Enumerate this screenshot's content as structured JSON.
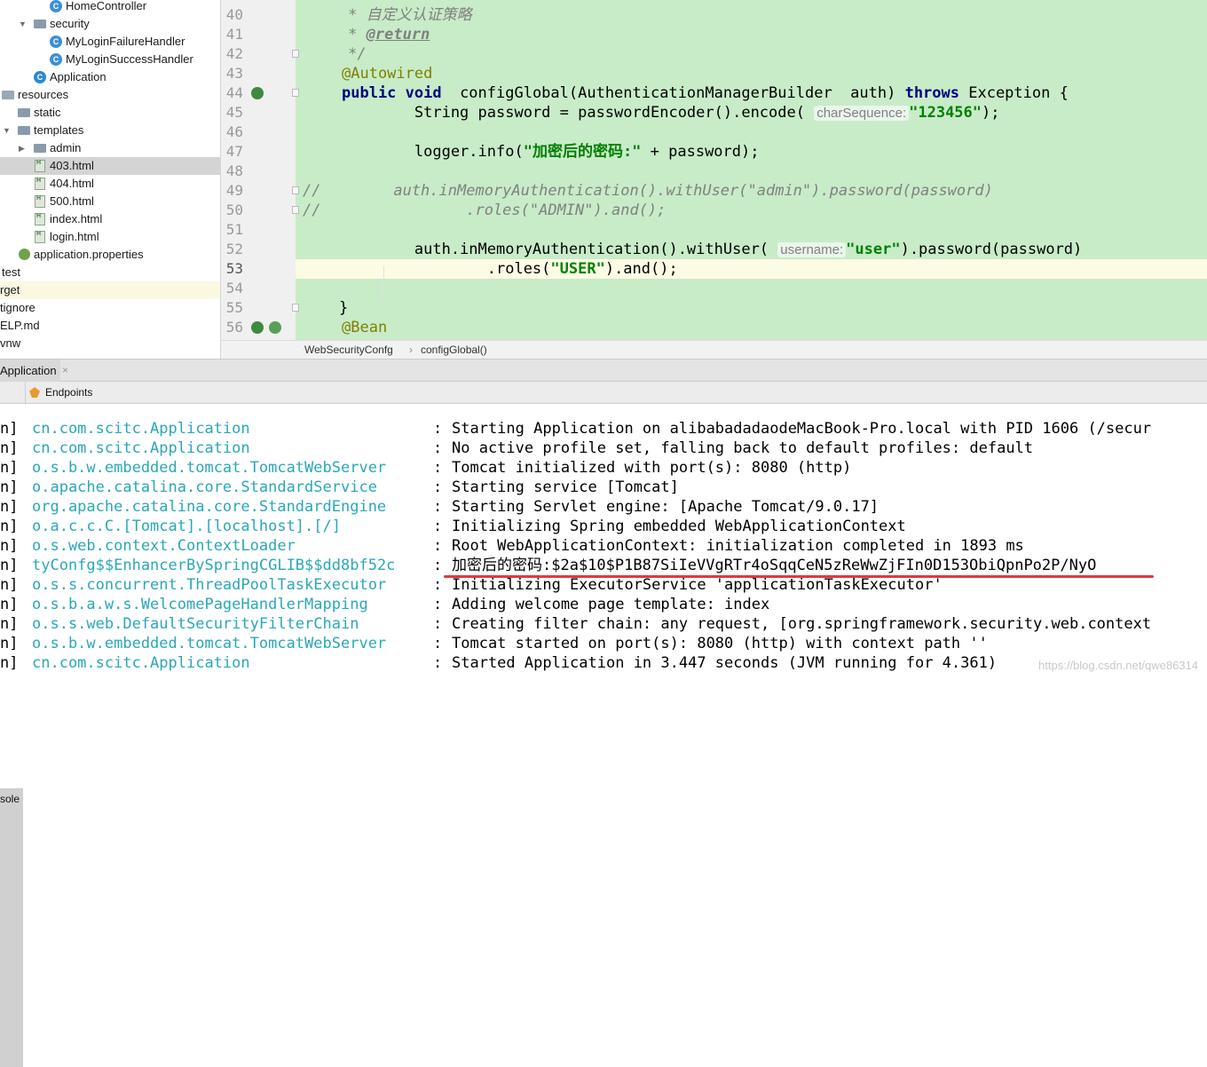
{
  "project_tree": [
    {
      "label": "HomeController",
      "icon": "class-icon"
    },
    {
      "label": "security",
      "icon": "folder-icon",
      "expanded": true
    },
    {
      "label": "MyLoginFailureHandler",
      "icon": "class-icon"
    },
    {
      "label": "MyLoginSuccessHandler",
      "icon": "class-icon"
    },
    {
      "label": "Application",
      "icon": "spring-app-class-icon"
    },
    {
      "label": "resources",
      "icon": "resources-folder-icon",
      "expanded": true
    },
    {
      "label": "static",
      "icon": "folder-icon"
    },
    {
      "label": "templates",
      "icon": "folder-icon",
      "expanded": true
    },
    {
      "label": "admin",
      "icon": "folder-icon",
      "expanded": false
    },
    {
      "label": "403.html",
      "icon": "html-file-icon",
      "selected": true
    },
    {
      "label": "404.html",
      "icon": "html-file-icon"
    },
    {
      "label": "500.html",
      "icon": "html-file-icon"
    },
    {
      "label": "index.html",
      "icon": "html-file-icon"
    },
    {
      "label": "login.html",
      "icon": "html-file-icon"
    },
    {
      "label": "application.properties",
      "icon": "properties-file-icon"
    },
    {
      "label": "test",
      "icon": "none"
    },
    {
      "label": "rget",
      "icon": "none"
    },
    {
      "label": "tignore",
      "icon": "none"
    },
    {
      "label": "ELP.md",
      "icon": "none"
    },
    {
      "label": "vnw",
      "icon": "none"
    }
  ],
  "editor": {
    "line_numbers": [
      "40",
      "41",
      "42",
      "43",
      "44",
      "45",
      "46",
      "47",
      "48",
      "49",
      "50",
      "51",
      "52",
      "53",
      "54",
      "55",
      "56"
    ],
    "current_line": "53",
    "code": {
      "l40": "     * 自定义认证策略",
      "l41_prefix": "     * ",
      "l41_tag": "@return",
      "l42": "     */",
      "l43": "@Autowired",
      "l44_kw1": "public void",
      "l44_mid": "  configGlobal(AuthenticationManagerBuilder  auth) ",
      "l44_kw2": "throws",
      "l44_end": " Exception {",
      "l45_a": "        String password = passwordEncoder().encode( ",
      "l45_hint": "charSequence:",
      "l45_str": "\"123456\"",
      "l45_end": ");",
      "l47_a": "        logger.info(",
      "l47_str": "\"加密后的密码:\"",
      "l47_end": " + password);",
      "l49": "//        auth.inMemoryAuthentication().withUser(\"admin\").password(password)",
      "l50": "//                .roles(\"ADMIN\").and();",
      "l52_a": "        auth.inMemoryAuthentication().withUser( ",
      "l52_hint": "username:",
      "l52_str": "\"user\"",
      "l52_end": ").password(password)",
      "l53_a": "                .roles(",
      "l53_str": "\"USER\"",
      "l53_end": ").and();",
      "l55": "    }",
      "l56": "@Bean"
    },
    "breadcrumb": [
      "WebSecurityConfg",
      "configGlobal()"
    ]
  },
  "run_panel": {
    "tab_label": "Application",
    "close_glyph": "×",
    "subtabs": [
      "sole",
      "Endpoints"
    ]
  },
  "console": [
    {
      "pre": "n]",
      "logger": "cn.com.scitc.Application",
      "colon": ":",
      "msg": "Starting Application on alibabadadaodeMacBook-Pro.local with PID 1606 (/secur"
    },
    {
      "pre": "n]",
      "logger": "cn.com.scitc.Application",
      "colon": ":",
      "msg": "No active profile set, falling back to default profiles: default"
    },
    {
      "pre": "n]",
      "logger": "o.s.b.w.embedded.tomcat.TomcatWebServer",
      "colon": ":",
      "msg": "Tomcat initialized with port(s): 8080 (http)"
    },
    {
      "pre": "n]",
      "logger": "o.apache.catalina.core.StandardService",
      "colon": ":",
      "msg": "Starting service [Tomcat]"
    },
    {
      "pre": "n]",
      "logger": "org.apache.catalina.core.StandardEngine",
      "colon": ":",
      "msg": "Starting Servlet engine: [Apache Tomcat/9.0.17]"
    },
    {
      "pre": "n]",
      "logger": "o.a.c.c.C.[Tomcat].[localhost].[/]",
      "colon": ":",
      "msg": "Initializing Spring embedded WebApplicationContext"
    },
    {
      "pre": "n]",
      "logger": "o.s.web.context.ContextLoader",
      "colon": ":",
      "msg": "Root WebApplicationContext: initialization completed in 1893 ms"
    },
    {
      "pre": "n]",
      "logger": "tyConfg$$EnhancerBySpringCGLIB$$dd8bf52c",
      "colon": ":",
      "msg": "加密后的密码:$2a$10$P1B87SiIeVVgRTr4oSqqCeN5zReWwZjFIn0D153ObiQpnPo2P/NyO"
    },
    {
      "pre": "n]",
      "logger": "o.s.s.concurrent.ThreadPoolTaskExecutor",
      "colon": ":",
      "msg": "Initializing ExecutorService 'applicationTaskExecutor'"
    },
    {
      "pre": "n]",
      "logger": "o.s.b.a.w.s.WelcomePageHandlerMapping",
      "colon": ":",
      "msg": "Adding welcome page template: index"
    },
    {
      "pre": "n]",
      "logger": "o.s.s.web.DefaultSecurityFilterChain",
      "colon": ":",
      "msg": "Creating filter chain: any request, [org.springframework.security.web.context"
    },
    {
      "pre": "n]",
      "logger": "o.s.b.w.embedded.tomcat.TomcatWebServer",
      "colon": ":",
      "msg": "Tomcat started on port(s): 8080 (http) with context path ''"
    },
    {
      "pre": "n]",
      "logger": "cn.com.scitc.Application",
      "colon": ":",
      "msg": "Started Application in 3.447 seconds (JVM running for 4.361)"
    }
  ],
  "watermark": "https://blog.csdn.net/qwe86314",
  "colors": {
    "editor_bg": "#c8ecc8",
    "logger": "#2aa7b9",
    "underline": "#e23a3a"
  }
}
